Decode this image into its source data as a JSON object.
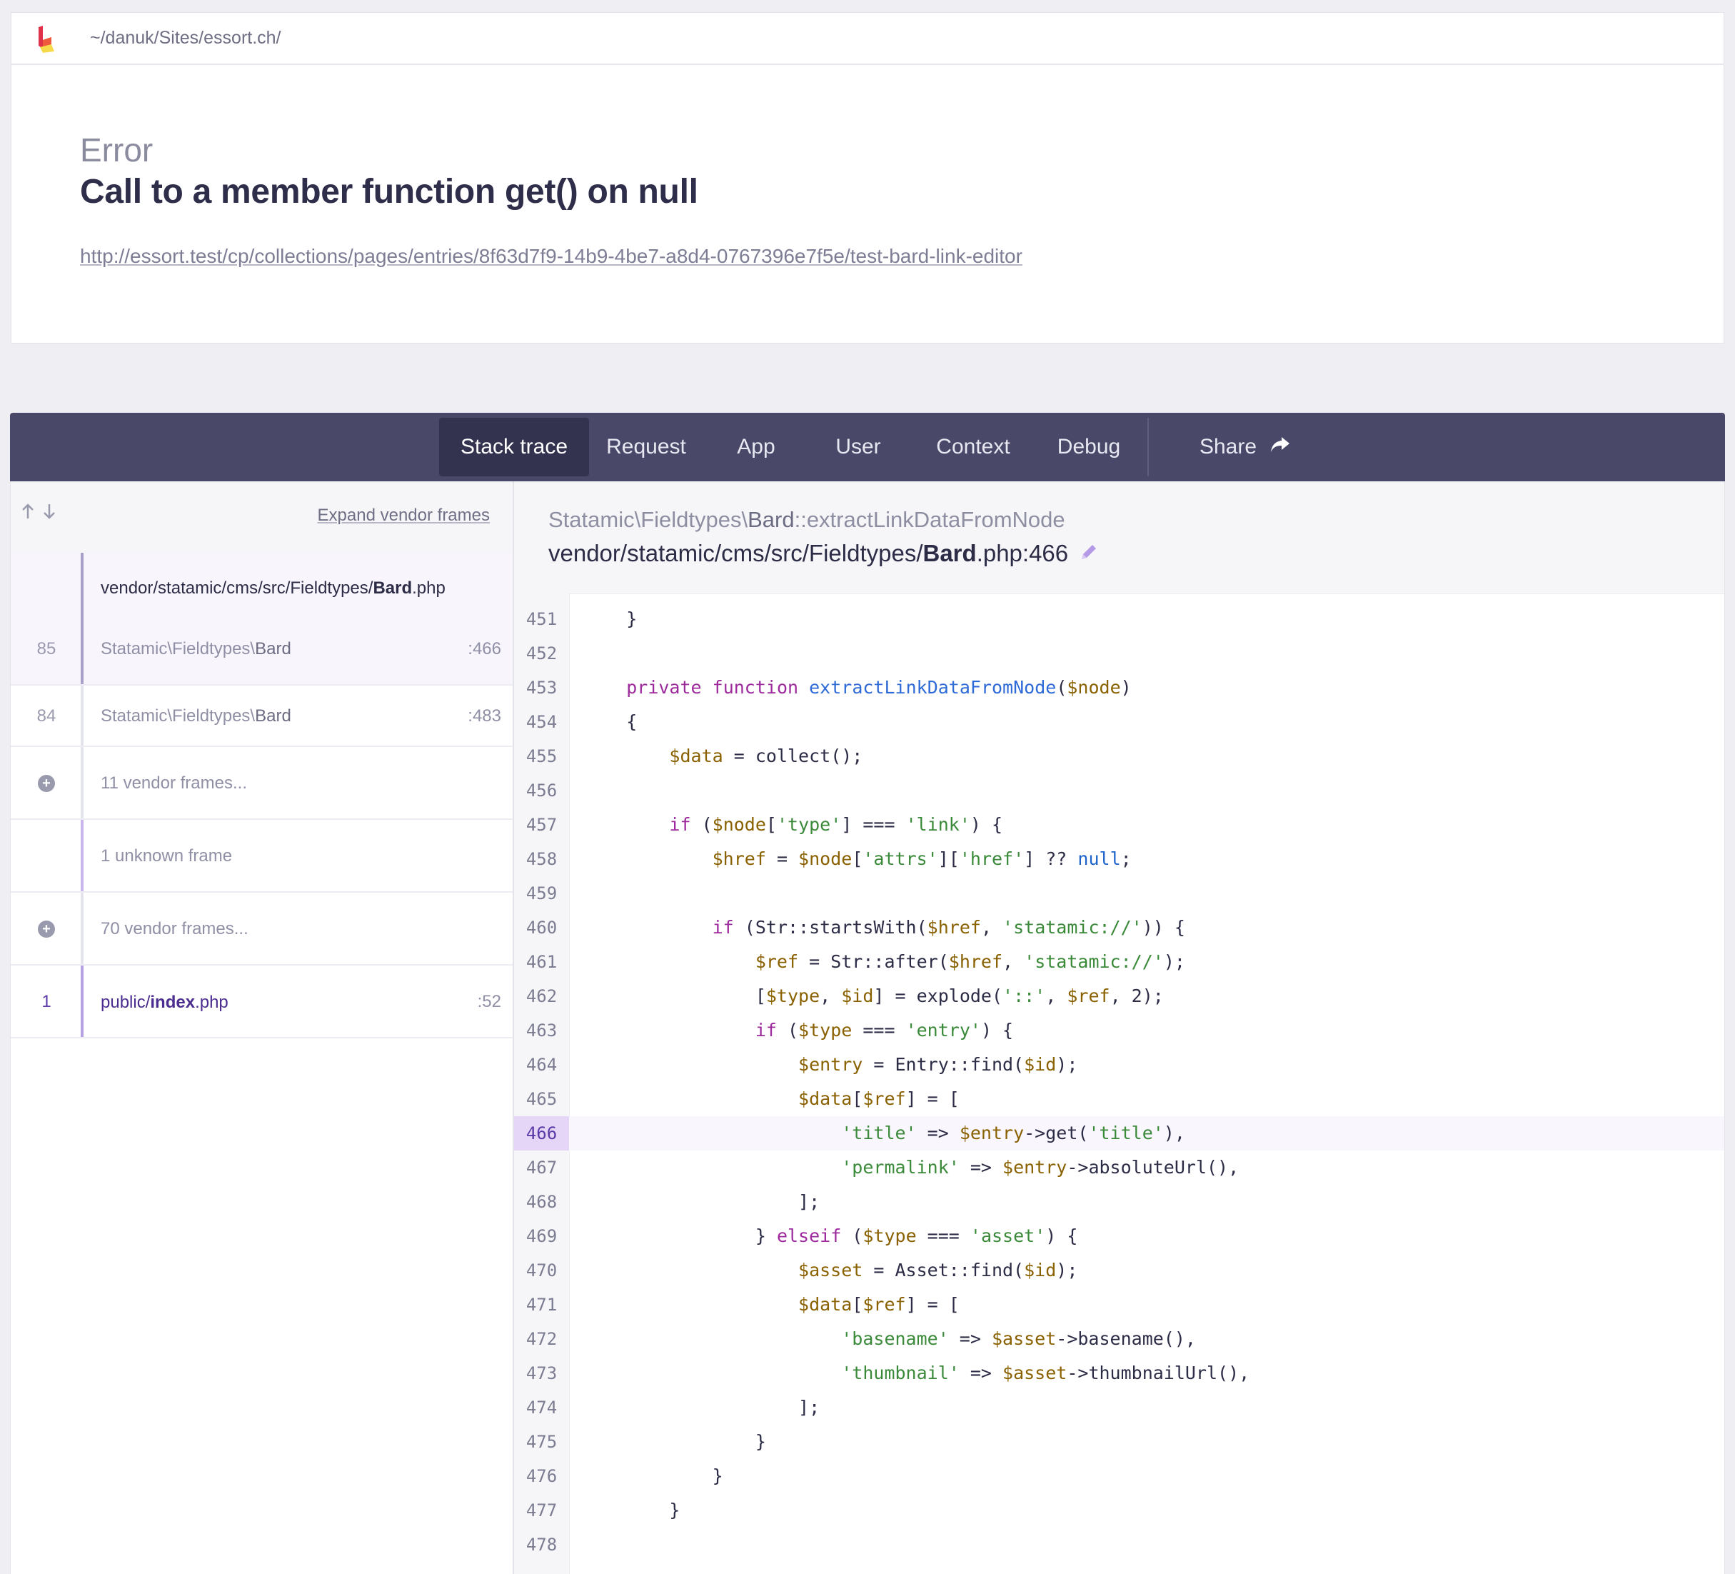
{
  "topbar": {
    "path": "~/danuk/Sites/essort.ch/"
  },
  "header": {
    "exception_class": "Error",
    "message": "Call to a member function get() on null",
    "url": "http://essort.test/cp/collections/pages/entries/8f63d7f9-14b9-4be7-a8d4-0767396e7f5e/test-bard-link-editor"
  },
  "tabs": [
    {
      "label": "Stack trace",
      "active": true
    },
    {
      "label": "Request",
      "active": false
    },
    {
      "label": "App",
      "active": false
    },
    {
      "label": "User",
      "active": false
    },
    {
      "label": "Context",
      "active": false
    },
    {
      "label": "Debug",
      "active": false
    },
    {
      "label": "Share",
      "active": false
    }
  ],
  "sidebar": {
    "expand_label": "Expand vendor frames",
    "frames": [
      {
        "num": "85",
        "file_dir": "vendor/statamic/cms/src/Fieldtypes/",
        "file_name": "Bard",
        "file_ext": ".php",
        "cls_prefix": "Statamic\\Fieldtypes\\",
        "cls_name": "Bard",
        "line": ":466"
      },
      {
        "num": "84",
        "cls_prefix": "Statamic\\Fieldtypes\\",
        "cls_name": "Bard",
        "line": ":483"
      },
      {
        "label": "11 vendor frames..."
      },
      {
        "label": "1 unknown frame"
      },
      {
        "label": "70 vendor frames..."
      },
      {
        "num": "1",
        "file_dir": "public/",
        "file_name": "index",
        "file_ext": ".php",
        "line": ":52"
      }
    ]
  },
  "code": {
    "method_prefix": "Statamic\\Fieldtypes\\",
    "method_class": "Bard",
    "method_name": "::extractLinkDataFromNode",
    "file_dir": "vendor/statamic/cms/src/Fieldtypes/",
    "file_name": "Bard",
    "file_ext": ".php:466",
    "highlight_line": "466",
    "line_numbers": [
      "451",
      "452",
      "453",
      "454",
      "455",
      "456",
      "457",
      "458",
      "459",
      "460",
      "461",
      "462",
      "463",
      "464",
      "465",
      "466",
      "467",
      "468",
      "469",
      "470",
      "471",
      "472",
      "473",
      "474",
      "475",
      "476",
      "477",
      "478"
    ],
    "lines": [
      "    }",
      "",
      "    private function extractLinkDataFromNode($node)",
      "    {",
      "        $data = collect();",
      "",
      "        if ($node['type'] === 'link') {",
      "            $href = $node['attrs']['href'] ?? null;",
      "",
      "            if (Str::startsWith($href, 'statamic://')) {",
      "                $ref = Str::after($href, 'statamic://');",
      "                [$type, $id] = explode('::', $ref, 2);",
      "                if ($type === 'entry') {",
      "                    $entry = Entry::find($id);",
      "                    $data[$ref] = [",
      "                        'title' => $entry->get('title'),",
      "                        'permalink' => $entry->absoluteUrl(),",
      "                    ];",
      "                } elseif ($type === 'asset') {",
      "                    $asset = Asset::find($id);",
      "                    $data[$ref] = [",
      "                        'basename' => $asset->basename(),",
      "                        'thumbnail' => $asset->thumbnailUrl(),",
      "                    ];",
      "                }",
      "            }",
      "        }",
      ""
    ]
  },
  "colors": {
    "tab_bar": "#4a4868",
    "tab_active": "#34334f",
    "keyword": "#9c2a9c",
    "function": "#2f6bd6",
    "variable": "#8a6100",
    "string": "#3a8a3a",
    "highlight_gutter": "#e5d6f7"
  }
}
